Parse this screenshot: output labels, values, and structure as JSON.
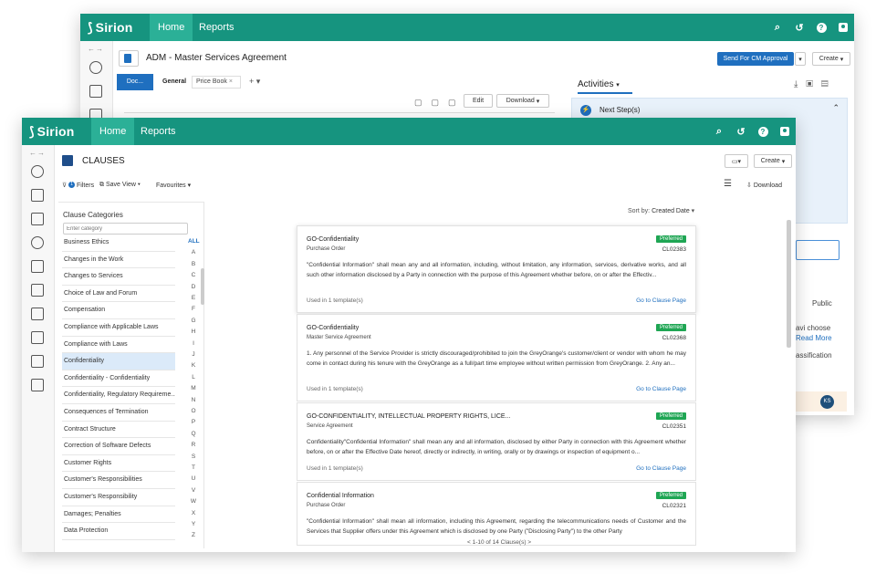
{
  "back_window": {
    "logo": "Sirion",
    "nav": [
      "Home",
      "Reports"
    ],
    "doc_title": "ADM - Master Services Agreement",
    "send_button": "Send For CM Approval",
    "create_button": "Create",
    "doc_tab": "Doc...",
    "tabs": [
      "General",
      "Price Book"
    ],
    "edit_button": "Edit",
    "download_button": "Download",
    "activities": "Activities",
    "next_steps": "Next Step(s)",
    "fragments": [
      "Public",
      "avi choose",
      "Read More",
      "assification"
    ],
    "avatar": "KS"
  },
  "front_window": {
    "logo": "Sirion",
    "nav": [
      "Home",
      "Reports"
    ],
    "page_title": "CLAUSES",
    "create_button": "Create",
    "filters": "Filters",
    "filters_count": "1",
    "save_view": "Save View",
    "favourites": "Favourites",
    "download": "Download",
    "categories_title": "Clause Categories",
    "search_placeholder": "Enter category",
    "sort_label": "Sort by:",
    "sort_value": "Created Date",
    "alphabet": [
      "ALL",
      "A",
      "B",
      "C",
      "D",
      "E",
      "F",
      "G",
      "H",
      "I",
      "J",
      "K",
      "L",
      "M",
      "N",
      "O",
      "P",
      "Q",
      "R",
      "S",
      "T",
      "U",
      "V",
      "W",
      "X",
      "Y",
      "Z"
    ],
    "categories": [
      "Business Ethics",
      "Changes in the Work",
      "Changes to Services",
      "Choice of Law and Forum",
      "Compensation",
      "Compliance with Applicable Laws",
      "Compliance with Laws",
      "Confidentiality",
      "Confidentiality - Confidentiality",
      "Confidentiality, Regulatory Requireme...",
      "Consequences of Termination",
      "Contract Structure",
      "Correction of Software Defects",
      "Customer Rights",
      "Customer's Responsibilities",
      "Customer's Responsibility",
      "Damages; Penalties",
      "Data Protection"
    ],
    "selected_category": "Confidentiality",
    "clauses": [
      {
        "title": "GO-Confidentiality",
        "type": "Purchase Order",
        "badge": "Preferred",
        "id": "CL02383",
        "text": "\"Confidential Information\" shall mean any and all information, including, without limitation, any information, services, derivative works, and all such other information disclosed by a Party in connection with the purpose of this Agreement whether before, on or after the Effectiv...",
        "used": "Used in 1 template(s)",
        "link": "Go to Clause Page"
      },
      {
        "title": "GO-Confidentiality",
        "type": "Master Service Agreement",
        "badge": "Preferred",
        "id": "CL02368",
        "text": "1. Any personnel of the Service Provider is strictly discouraged/prohibited to join the GreyOrange's customer/client or vendor with whom he may come in contact during his tenure with the GreyOrange as a full/part time employee without written permission from GreyOrange. 2. Any an...",
        "used": "Used in 1 template(s)",
        "link": "Go to Clause Page"
      },
      {
        "title": "GO-CONFIDENTIALITY, INTELLECTUAL PROPERTY RIGHTS, LICE...",
        "type": "Service Agreement",
        "badge": "Preferred",
        "id": "CL02351",
        "text": "Confidentiality\"Confidential Information\" shall mean any and all information, disclosed by either Party in connection with this Agreement whether before, on or after the Effective Date hereof, directly or indirectly, in writing, orally or by drawings or inspection of equipment o...",
        "used": "Used in 1 template(s)",
        "link": "Go to Clause Page"
      },
      {
        "title": "Confidential Information",
        "type": "Purchase Order",
        "badge": "Preferred",
        "id": "CL02321",
        "text": "\"Confidential Information\" shall mean all information, including this Agreement, regarding the telecommunications needs of Customer and the Services that Supplier offers under this Agreement which is disclosed by one Party (\"Disclosing Party\") to the other Party",
        "used": "",
        "link": ""
      }
    ],
    "pagination": "< 1-10 of 14 Clause(s) >"
  }
}
